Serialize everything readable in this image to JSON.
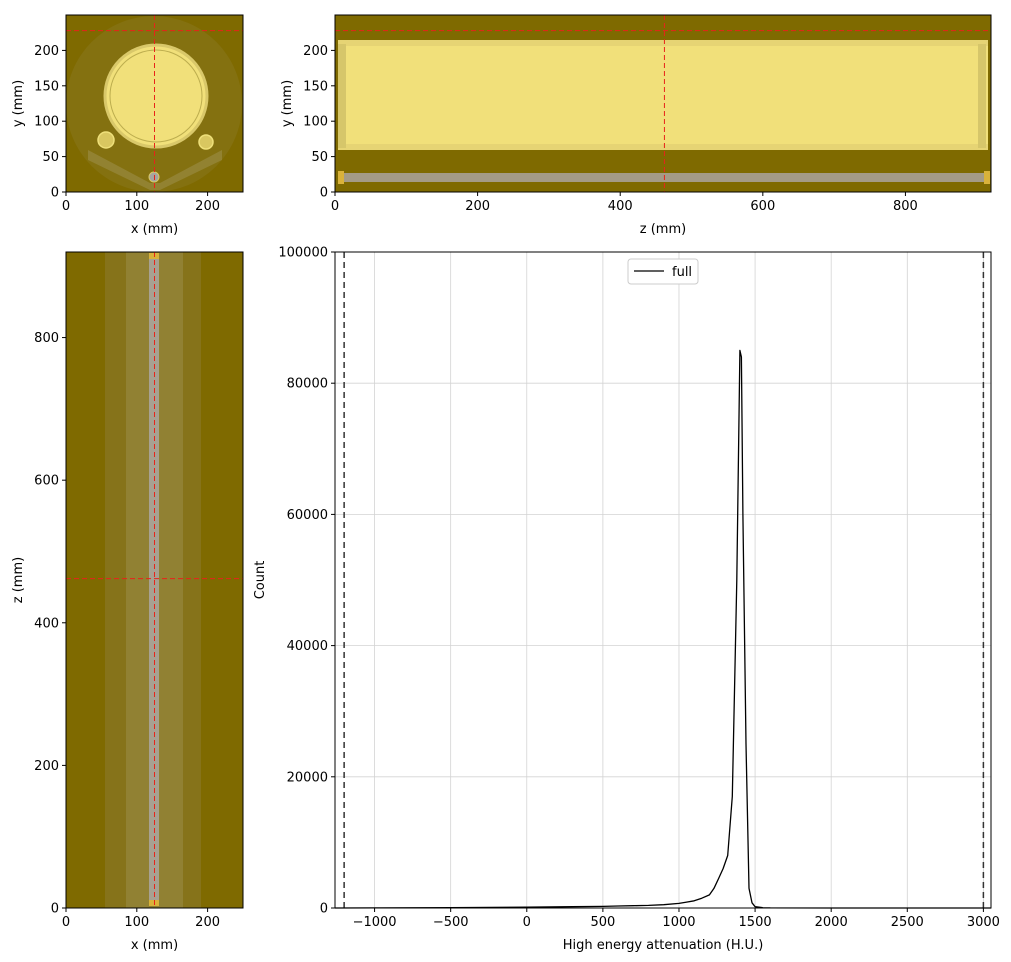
{
  "panels": {
    "axial": {
      "xlabel": "x (mm)",
      "ylabel": "y (mm)",
      "xlim": [
        0,
        250
      ],
      "ylim": [
        250,
        0
      ],
      "xticks": [
        0,
        100,
        200
      ],
      "yticks": [
        0,
        50,
        100,
        150,
        200
      ],
      "cross_x": 125,
      "cross_y": 228
    },
    "sagittal_zy": {
      "xlabel": "z (mm)",
      "ylabel": "y (mm)",
      "xlim": [
        0,
        920
      ],
      "ylim": [
        250,
        0
      ],
      "xticks": [
        0,
        200,
        400,
        600,
        800
      ],
      "yticks": [
        0,
        50,
        100,
        150,
        200
      ],
      "cross_z": 462,
      "cross_y": 228
    },
    "coronal_xz": {
      "xlabel": "x (mm)",
      "ylabel": "z (mm)",
      "xlim": [
        0,
        250
      ],
      "ylim": [
        920,
        0
      ],
      "xticks": [
        0,
        100,
        200
      ],
      "yticks": [
        0,
        200,
        400,
        600,
        800
      ],
      "cross_x": 125,
      "cross_z": 462
    }
  },
  "colors": {
    "background_slice": "#7f6a00",
    "core_fill": "#f3e27a",
    "liner": "#a99a50",
    "crosshair": "#e8231a",
    "ruler": "#9a8f80"
  },
  "chart_data": {
    "type": "line",
    "xlabel": "High energy attenuation (H.U.)",
    "ylabel": "Count",
    "xlim": [
      -1260,
      3050
    ],
    "ylim": [
      0,
      100000
    ],
    "xticks": [
      -1000,
      -500,
      0,
      500,
      1000,
      1500,
      2000,
      2500,
      3000
    ],
    "yticks": [
      0,
      20000,
      40000,
      60000,
      80000,
      100000
    ],
    "grid": true,
    "legend_position": "top-center",
    "vlines": [
      -1200,
      3000
    ],
    "series": [
      {
        "name": "full",
        "color": "#000000",
        "x": [
          -1260,
          -1000,
          -500,
          0,
          300,
          500,
          600,
          700,
          800,
          900,
          1000,
          1050,
          1100,
          1150,
          1200,
          1230,
          1260,
          1290,
          1320,
          1350,
          1380,
          1400,
          1410,
          1420,
          1440,
          1460,
          1480,
          1500,
          1550,
          1600,
          2000,
          3050
        ],
        "y": [
          0,
          20,
          60,
          120,
          200,
          250,
          300,
          350,
          400,
          500,
          700,
          900,
          1100,
          1500,
          2000,
          3000,
          4500,
          6000,
          8000,
          17000,
          50000,
          85000,
          84000,
          60000,
          25000,
          3000,
          800,
          200,
          50,
          20,
          0,
          0
        ]
      }
    ]
  }
}
